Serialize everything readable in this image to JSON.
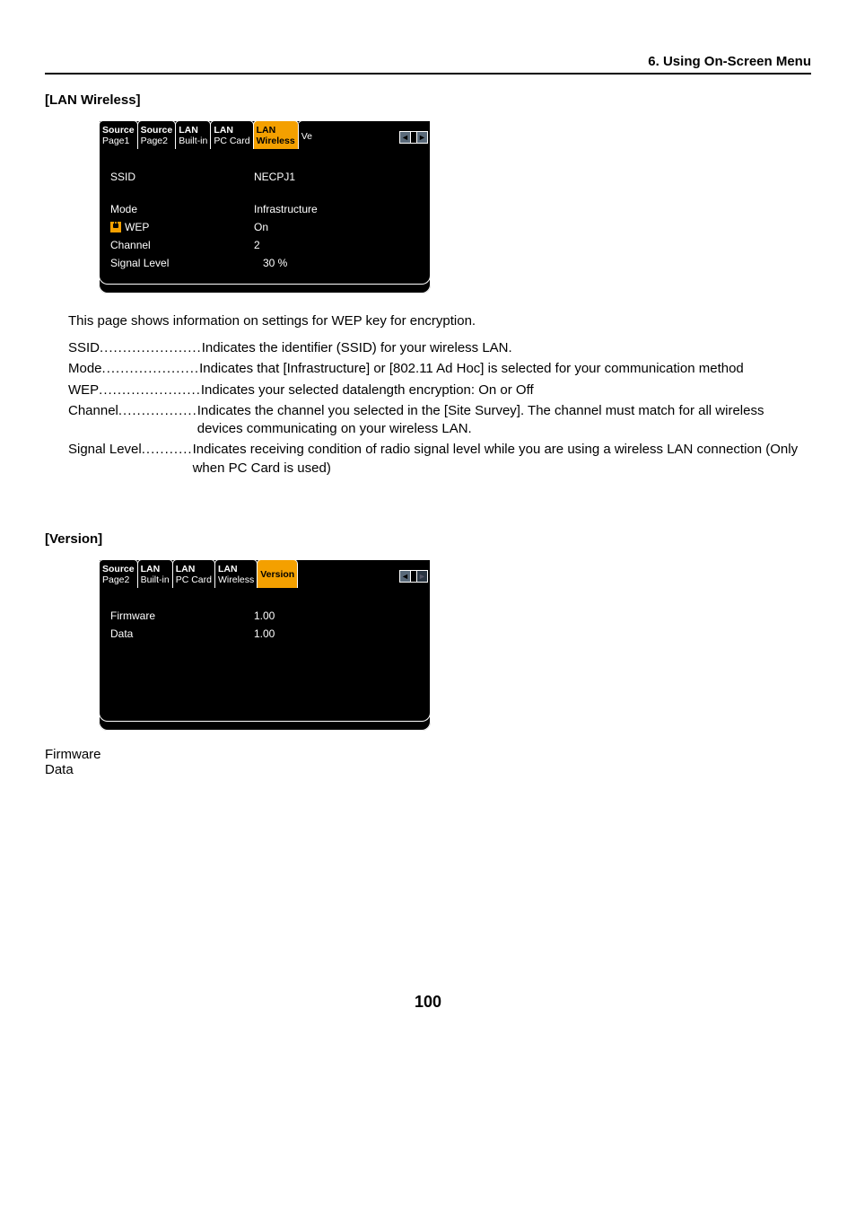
{
  "chapter_header": "6. Using On-Screen Menu",
  "section_lan_wireless": {
    "title": "[LAN Wireless]",
    "tabs": [
      {
        "line1": "Source",
        "line2": "Page1"
      },
      {
        "line1": "Source",
        "line2": "Page2"
      },
      {
        "line1": "LAN",
        "line2": "Built-in"
      },
      {
        "line1": "LAN",
        "line2": "PC Card"
      },
      {
        "line1": "LAN",
        "line2": "Wireless"
      }
    ],
    "tab_cut": "Ve",
    "rows": {
      "ssid_label": "SSID",
      "ssid_value": "NECPJ1",
      "mode_label": "Mode",
      "mode_value": "Infrastructure",
      "wep_label": "WEP",
      "wep_value": "On",
      "channel_label": "Channel",
      "channel_value": "2",
      "signal_label": "Signal Level",
      "signal_value": "30 %"
    },
    "desc": "This page shows information on settings for WEP key for encryption.",
    "definitions": [
      {
        "term": "SSID",
        "dots": " ...................... ",
        "desc": "Indicates the identifier (SSID) for your wireless LAN."
      },
      {
        "term": "Mode",
        "dots": " ..................... ",
        "desc": "Indicates that [Infrastructure] or [802.11 Ad Hoc] is selected for your communication method"
      },
      {
        "term": "WEP",
        "dots": " ...................... ",
        "desc": "Indicates your selected datalength encryption: On or Off"
      },
      {
        "term": "Channel",
        "dots": " ................. ",
        "desc": "Indicates the channel you selected in the [Site Survey]. The channel must match for all wireless devices communicating on your wireless LAN."
      },
      {
        "term": "Signal Level",
        "dots": " ........... ",
        "desc": "Indicates receiving condition of radio signal level while you are using a wireless LAN connection (Only when PC Card is used)"
      }
    ]
  },
  "section_version": {
    "title": "[Version]",
    "tabs": [
      {
        "line1": "Source",
        "line2": "Page2"
      },
      {
        "line1": "LAN",
        "line2": "Built-in"
      },
      {
        "line1": "LAN",
        "line2": "PC Card"
      },
      {
        "line1": "LAN",
        "line2": "Wireless"
      },
      {
        "line1": "Version",
        "line2": ""
      }
    ],
    "rows": {
      "firmware_label": "Firmware",
      "firmware_value": "1.00",
      "data_label": "Data",
      "data_value": "1.00"
    },
    "simple_list": [
      "Firmware",
      "Data"
    ]
  },
  "arrows": {
    "left": "◄",
    "right": "►"
  },
  "page_number": "100"
}
